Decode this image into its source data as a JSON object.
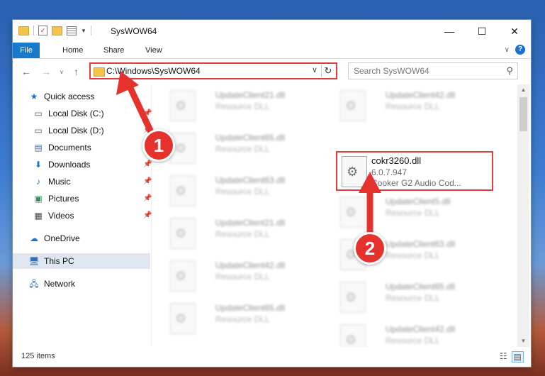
{
  "window": {
    "title": "SysWOW64",
    "minimize": "—",
    "maximize": "☐",
    "close": "✕"
  },
  "ribbon": {
    "tabs": [
      "File",
      "Home",
      "Share",
      "View"
    ],
    "expand": "∨",
    "help": "?"
  },
  "address": {
    "path": "C:\\Windows\\SysWOW64",
    "search_placeholder": "Search SysWOW64"
  },
  "nav": {
    "items": [
      {
        "label": "Quick access",
        "icon": "star-icon",
        "pinned": false
      },
      {
        "label": "Local Disk (C:)",
        "icon": "drive-icon",
        "pinned": true
      },
      {
        "label": "Local Disk (D:)",
        "icon": "drive-icon",
        "pinned": true
      },
      {
        "label": "Documents",
        "icon": "documents-icon",
        "pinned": true
      },
      {
        "label": "Downloads",
        "icon": "download-icon",
        "pinned": true
      },
      {
        "label": "Music",
        "icon": "music-icon",
        "pinned": true
      },
      {
        "label": "Pictures",
        "icon": "pictures-icon",
        "pinned": true
      },
      {
        "label": "Videos",
        "icon": "videos-icon",
        "pinned": true
      },
      {
        "label": "OneDrive",
        "icon": "cloud-icon",
        "pinned": false
      },
      {
        "label": "This PC",
        "icon": "computer-icon",
        "pinned": false
      },
      {
        "label": "Network",
        "icon": "network-icon",
        "pinned": false
      }
    ]
  },
  "files": {
    "blurred": [
      {
        "name": "UpdateClient21.dll",
        "type": "Resource DLL"
      },
      {
        "name": "UpdateClient42.dll",
        "type": "Resource DLL"
      },
      {
        "name": "UpdateClient65.dll",
        "type": "Resource DLL"
      },
      {
        "name": "UpdateClient63.dll",
        "type": "Resource DLL"
      },
      {
        "name": "UpdateClient5.dll",
        "type": "Resource DLL"
      },
      {
        "name": "UpdateClient21.dll",
        "type": "Resource DLL"
      },
      {
        "name": "UpdateClient63.dll",
        "type": "Resource DLL"
      },
      {
        "name": "UpdateClient42.dll",
        "type": "Resource DLL"
      },
      {
        "name": "UpdateClient65.dll",
        "type": "Resource DLL"
      },
      {
        "name": "UpdateClient65.dll",
        "type": "Resource DLL"
      },
      {
        "name": "UpdateClient42.dll",
        "type": "Resource DLL"
      }
    ],
    "highlighted": {
      "name": "cokr3260.dll",
      "version": "6.0.7.947",
      "description": "Cooker G2 Audio Cod..."
    }
  },
  "status": {
    "item_count": "125 items"
  },
  "annotations": {
    "step1": "1",
    "step2": "2",
    "color": "#e5322d"
  }
}
